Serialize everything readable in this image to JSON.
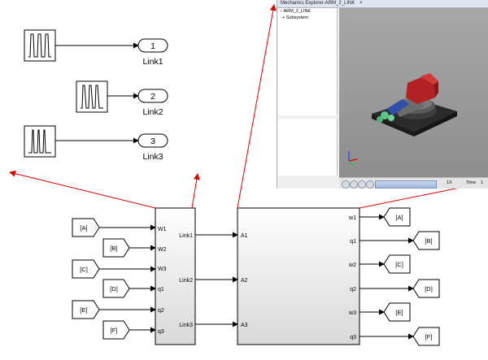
{
  "sources": [
    {
      "output_label": "1",
      "link_label": "Link1"
    },
    {
      "output_label": "2",
      "link_label": "Link2"
    },
    {
      "output_label": "3",
      "link_label": "Link3"
    }
  ],
  "subsystem1": {
    "inputs": [
      "W1",
      "W2",
      "W3",
      "q1",
      "q2",
      "q3"
    ],
    "outputs": [
      "Link1",
      "Link2",
      "Link3"
    ]
  },
  "subsystem2": {
    "inputs": [
      "A1",
      "A2",
      "A3"
    ],
    "outputs": [
      "w1",
      "q1",
      "w2",
      "q2",
      "w3",
      "q3"
    ]
  },
  "from_tags": [
    "[A]",
    "[B]",
    "[C]",
    "[D]",
    "[E]",
    "[F]"
  ],
  "goto_tags": [
    "[A]",
    "[B]",
    "[C]",
    "[D]",
    "[E]",
    "[F]"
  ],
  "mechanics_explorer": {
    "tab_title": "Mechanics Explorer-ARM_2_LINK",
    "tree_root": "ARM_2_LINK",
    "tree_child": "Subsystem",
    "speed": "1X",
    "time_label": "Time",
    "time_value": "1"
  },
  "colors": {
    "connector": "#000000",
    "annotation_arrow": "#e00000",
    "block_border": "#000000",
    "block_fill_top": "#ffffff",
    "block_fill_bottom": "#d9d9d9"
  }
}
